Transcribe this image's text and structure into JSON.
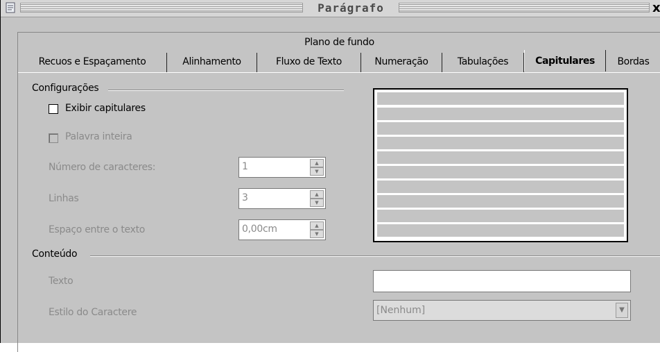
{
  "window": {
    "title": "Parágrafo",
    "close_glyph": "x"
  },
  "tabs_upper": {
    "label": "Plano de fundo"
  },
  "tabs": [
    {
      "label": "Recuos e Espaçamento",
      "active": false
    },
    {
      "label": "Alinhamento",
      "active": false
    },
    {
      "label": "Fluxo de Texto",
      "active": false
    },
    {
      "label": "Numeração",
      "active": false
    },
    {
      "label": "Tabulações",
      "active": false
    },
    {
      "label": "Capitulares",
      "active": true
    },
    {
      "label": "Bordas",
      "active": false
    }
  ],
  "settings": {
    "group_label": "Configurações",
    "show_dropcaps": {
      "label": "Exibir capitulares",
      "checked": false
    },
    "whole_word": {
      "label": "Palavra inteira",
      "checked": false,
      "enabled": false
    },
    "num_chars": {
      "label": "Número de caracteres:",
      "value": "1"
    },
    "lines": {
      "label": "Linhas",
      "value": "3"
    },
    "spacing": {
      "label": "Espaço entre o texto",
      "value": "0,00cm"
    }
  },
  "contents": {
    "group_label": "Conteúdo",
    "text": {
      "label": "Texto",
      "value": ""
    },
    "char_style": {
      "label": "Estilo do Caractere",
      "value": "[Nenhum]"
    }
  },
  "preview": {
    "line_count": 10
  }
}
